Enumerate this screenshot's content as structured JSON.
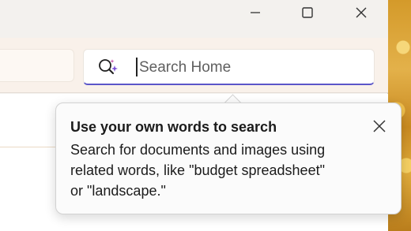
{
  "window": {
    "controls": {
      "minimize_icon": "minimize-icon",
      "maximize_icon": "maximize-icon",
      "close_icon": "close-icon"
    }
  },
  "search": {
    "placeholder": "Search Home",
    "icon": "sparkle-search-icon",
    "accent_color": "#5b56c9"
  },
  "teaching_tip": {
    "title": "Use your own words to search",
    "body_line1": "Search for documents and images using",
    "body_line2": "related words, like \"budget spreadsheet\"",
    "body_line3": "or \"landscape.\"",
    "close_icon": "close-icon"
  }
}
